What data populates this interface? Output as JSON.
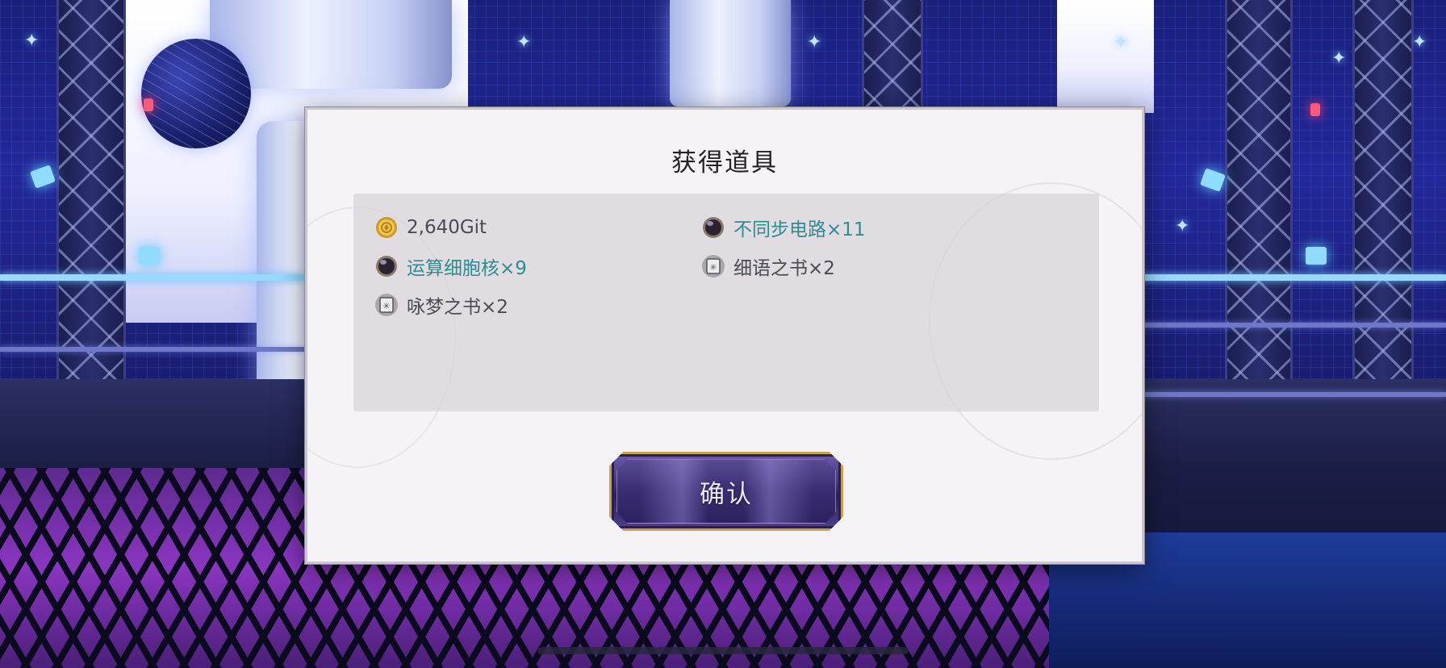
{
  "dialog": {
    "title": "获得道具",
    "confirm_label": "确认"
  },
  "items": [
    {
      "icon": "gold-coin-icon",
      "label": "2,640Git",
      "rare": false
    },
    {
      "icon": "dark-orb-icon",
      "label": "不同步电路×11",
      "rare": true
    },
    {
      "icon": "dark-orb-icon",
      "label": "运算细胞核×9",
      "rare": true
    },
    {
      "icon": "book-icon",
      "label": "细语之书×2",
      "rare": false
    },
    {
      "icon": "book-icon",
      "label": "咏梦之书×2",
      "rare": false
    }
  ],
  "colors": {
    "rare_text": "#2f8b8e",
    "normal_text": "#4a4a52",
    "button_border": "#c8a24a"
  }
}
